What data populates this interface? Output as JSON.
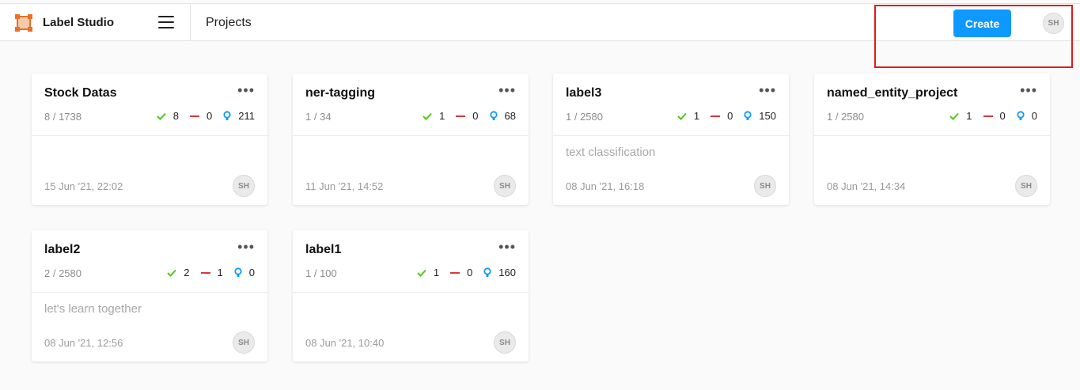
{
  "app": {
    "title": "Label Studio",
    "logo_icon": "label-studio-logo-icon"
  },
  "header": {
    "page_title": "Projects",
    "create_label": "Create",
    "user_initials": "SH",
    "accent_color": "#0d99ff"
  },
  "projects": [
    {
      "title": "Stock Datas",
      "progress": "8 / 1738",
      "completed": "8",
      "skipped": "0",
      "predictions": "211",
      "description": "",
      "date": "15 Jun '21, 22:02",
      "owner": "SH"
    },
    {
      "title": "ner-tagging",
      "progress": "1 / 34",
      "completed": "1",
      "skipped": "0",
      "predictions": "68",
      "description": "",
      "date": "11 Jun '21, 14:52",
      "owner": "SH"
    },
    {
      "title": "label3",
      "progress": "1 / 2580",
      "completed": "1",
      "skipped": "0",
      "predictions": "150",
      "description": "text classification",
      "date": "08 Jun '21, 16:18",
      "owner": "SH"
    },
    {
      "title": "named_entity_project",
      "progress": "1 / 2580",
      "completed": "1",
      "skipped": "0",
      "predictions": "0",
      "description": "",
      "date": "08 Jun '21, 14:34",
      "owner": "SH"
    },
    {
      "title": "label2",
      "progress": "2 / 2580",
      "completed": "2",
      "skipped": "1",
      "predictions": "0",
      "description": "let's learn together",
      "date": "08 Jun '21, 12:56",
      "owner": "SH"
    },
    {
      "title": "label1",
      "progress": "1 / 100",
      "completed": "1",
      "skipped": "0",
      "predictions": "160",
      "description": "",
      "date": "08 Jun '21, 10:40",
      "owner": "SH"
    }
  ],
  "card_menu_glyph": "•••",
  "colors": {
    "completed": "#52c41a",
    "skipped": "#d9363e",
    "predictions": "#0d99ff",
    "highlight": "#e11b1b"
  }
}
